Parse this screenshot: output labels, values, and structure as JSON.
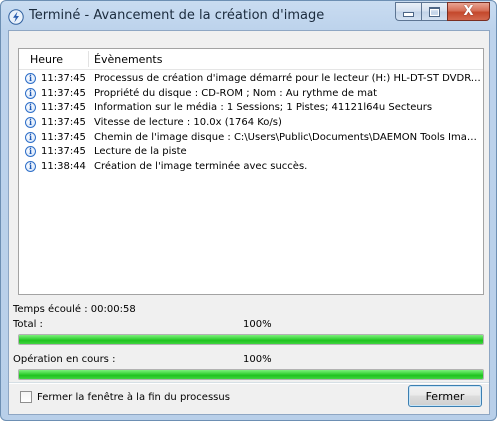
{
  "window": {
    "title": "Terminé - Avancement de la création d'image",
    "icon": "daemon-tools-lightning-icon",
    "close_glyph": "X"
  },
  "events": {
    "columns": [
      "Heure",
      "Évènements"
    ],
    "rows": [
      {
        "icon": "info-icon",
        "glyph": "i",
        "time": "11:37:45",
        "message": "Processus de création d'image démarré pour le lecteur (H:) HL-DT-ST DVDRAM ..."
      },
      {
        "icon": "info-icon",
        "glyph": "i",
        "time": "11:37:45",
        "message": "Propriété du disque : CD-ROM ; Nom : Au rythme de mat"
      },
      {
        "icon": "info-icon",
        "glyph": "i",
        "time": "11:37:45",
        "message": "Information sur le média : 1 Sessions; 1 Pistes; 41121l64u Secteurs"
      },
      {
        "icon": "info-icon",
        "glyph": "i",
        "time": "11:37:45",
        "message": "Vitesse de lecture : 10.0x (1764 Ko/s)"
      },
      {
        "icon": "info-icon",
        "glyph": "i",
        "time": "11:37:45",
        "message": "Chemin de l'image disque : C:\\Users\\Public\\Documents\\DAEMON Tools Images\\..."
      },
      {
        "icon": "info-icon",
        "glyph": "i",
        "time": "11:37:45",
        "message": "Lecture de la piste"
      },
      {
        "icon": "info-icon",
        "glyph": "i",
        "time": "11:38:44",
        "message": "Création de l'image terminée avec succès."
      }
    ]
  },
  "elapsed": {
    "text": "Temps écoulé : 00:00:58"
  },
  "total": {
    "label": "Total :",
    "percent_text": "100%",
    "progress": 1.0
  },
  "current_operation": {
    "label": "Opération en cours :",
    "percent_text": "100%",
    "progress": 1.0
  },
  "footer": {
    "close_on_finish_label": "Fermer la fenêtre à la fin du processus",
    "close_on_finish_checked": false,
    "close_button_label": "Fermer"
  },
  "colors": {
    "progress_green": "#1fc21f",
    "close_button_red": "#c4482c",
    "info_blue": "#2f6fc8"
  }
}
